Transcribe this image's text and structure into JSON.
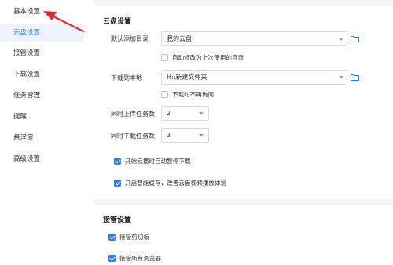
{
  "sidebar": {
    "items": [
      {
        "label": "基本设置",
        "active": false
      },
      {
        "label": "云盘设置",
        "active": true
      },
      {
        "label": "接管设置",
        "active": false
      },
      {
        "label": "下载设置",
        "active": false
      },
      {
        "label": "任务管理",
        "active": false
      },
      {
        "label": "提醒",
        "active": false
      },
      {
        "label": "悬浮窗",
        "active": false
      },
      {
        "label": "高级设置",
        "active": false
      }
    ]
  },
  "cloud": {
    "title": "云盘设置",
    "default_dir_label": "默认添加目录",
    "default_dir_value": "我的云盘",
    "auto_modify_label": "自动修改为上次使用的目录",
    "download_local_label": "下载到本地",
    "download_local_value": "H:\\新建文件夹",
    "no_ask_label": "下载时不再询问",
    "upload_count_label": "同时上传任务数",
    "upload_count_value": "2",
    "download_count_label": "同时下载任务数",
    "download_count_value": "3",
    "pause_download_label": "开始云播时自动暂停下载",
    "smart_cache_label": "开启智能缓存，改善云盘视频播放体验"
  },
  "takeover": {
    "title": "接管设置",
    "clipboard_label": "接管剪切板",
    "browsers_label": "接管所有浏览器"
  },
  "colors": {
    "accent": "#2c7ef8",
    "arrow": "#e02b2b",
    "background": "#f4f5f7"
  },
  "icons": [
    "folder-icon",
    "chevron-down-icon",
    "checkmark-icon",
    "red-arrow-annotation"
  ]
}
